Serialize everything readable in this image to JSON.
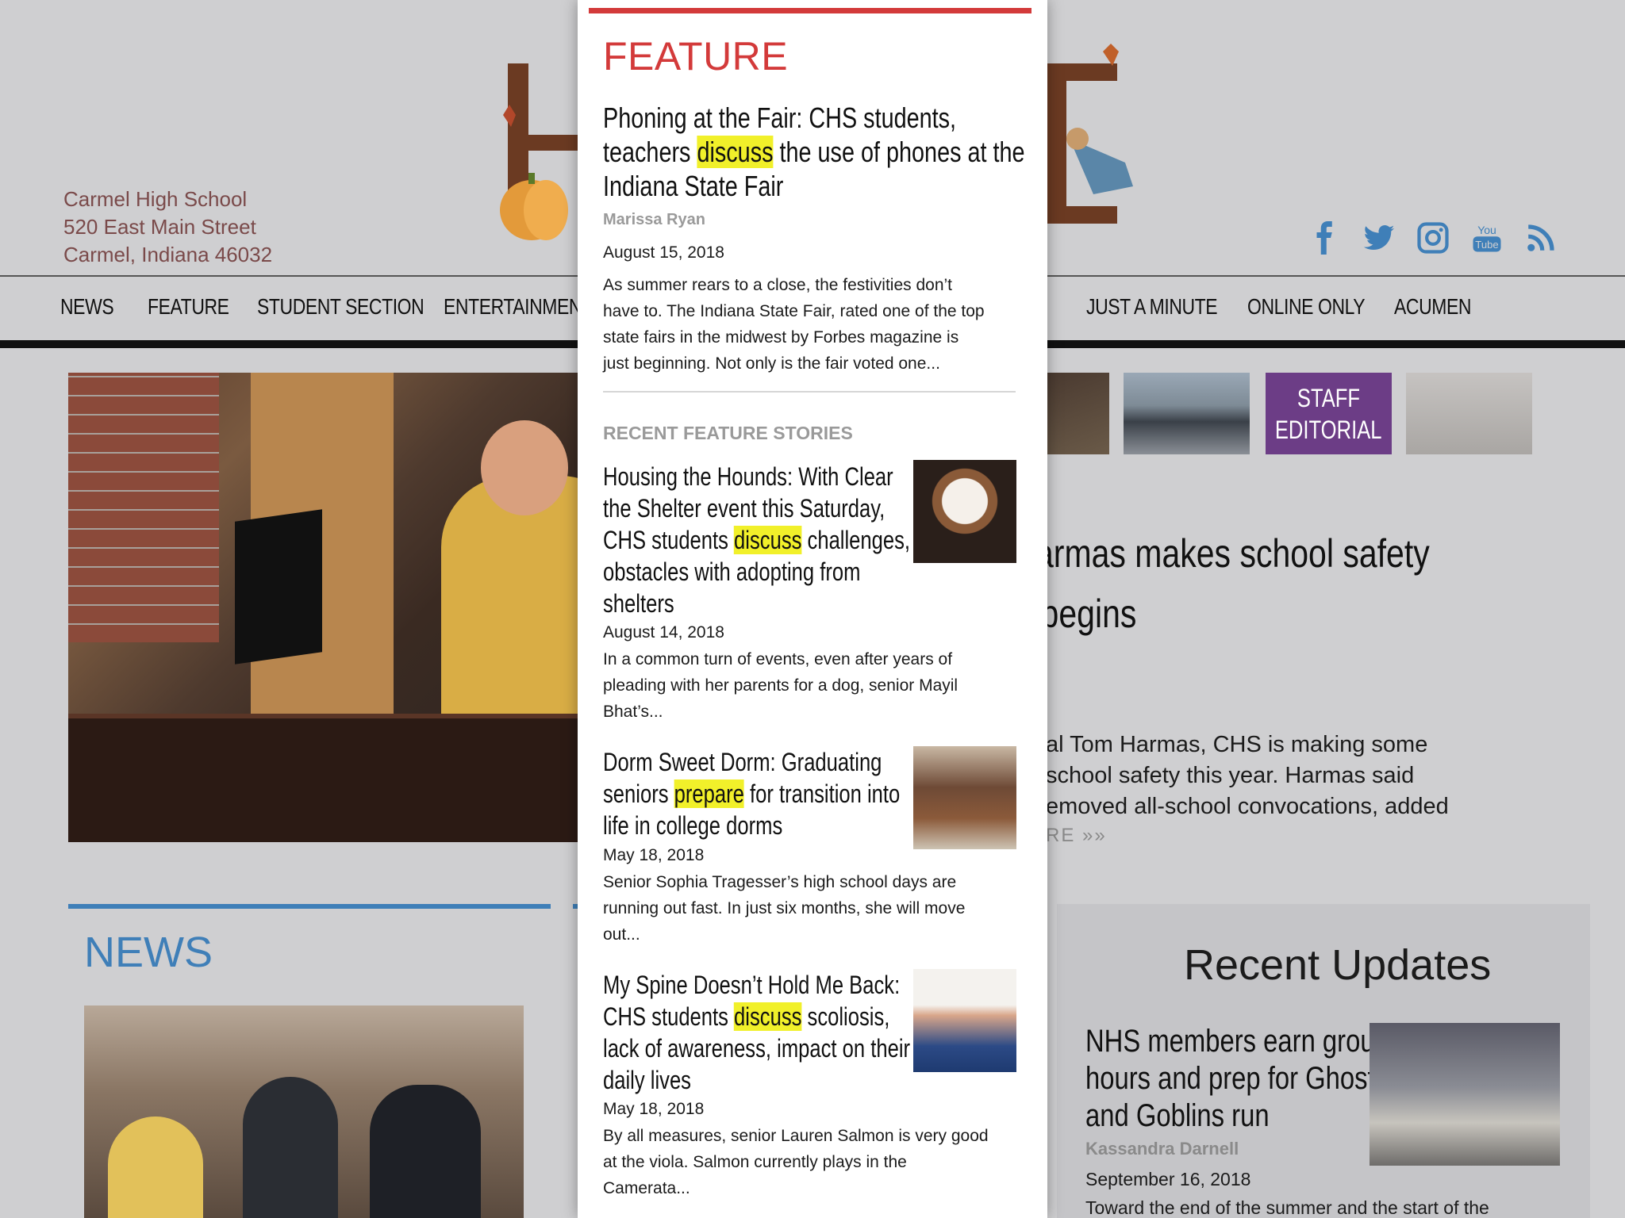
{
  "header": {
    "address_lines": [
      "Carmel High School",
      "520 East Main Street",
      "Carmel, Indiana 46032"
    ],
    "social_icons": [
      "facebook-icon",
      "twitter-icon",
      "instagram-icon",
      "youtube-icon",
      "rss-icon"
    ],
    "youtube_text_top": "You",
    "youtube_text_bottom": "Tube",
    "accent_color": "#3f7fb8"
  },
  "nav": {
    "items": [
      "NEWS",
      "FEATURE",
      "STUDENT SECTION",
      "ENTERTAINMENT",
      "JUST A MINUTE",
      "ONLINE ONLY",
      "ACUMEN"
    ]
  },
  "thumbs": {
    "staff_editorial_1": "STAFF",
    "staff_editorial_2": "EDITORIAL"
  },
  "main_story": {
    "headline_line1": "armas makes school safety",
    "headline_line2": "begins",
    "excerpt_line1": "al Tom Harmas, CHS is making some",
    "excerpt_line2": "school safety this year. Harmas said",
    "excerpt_line3": "emoved all-school convocations, added",
    "more": "RE »»"
  },
  "news_section": {
    "title": "NEWS"
  },
  "recent_updates": {
    "title": "Recent Updates",
    "headline_line1": "NHS members earn group",
    "headline_line2": "hours and prep for Ghost",
    "headline_line3": "and Goblins run",
    "author": "Kassandra Darnell",
    "date": "September 16, 2018",
    "excerpt": "Toward the end of the summer and the start of the"
  },
  "feature_panel": {
    "title": "FEATURE",
    "accent_color": "#d33a3a",
    "highlight_color": "#f1f02a",
    "main": {
      "headline_l1": "Phoning at the Fair: CHS students,",
      "headline_l2_pre": "teachers ",
      "headline_l2_hl": "discuss",
      "headline_l2_post": " the use of phones at the",
      "headline_l3": "Indiana State Fair",
      "author": "Marissa Ryan",
      "date": "August 15, 2018",
      "excerpt_l1": "As summer rears to a close, the festivities don’t",
      "excerpt_l2": "have to. The Indiana State Fair, rated one of the top",
      "excerpt_l3": "state fairs in the midwest by Forbes magazine is",
      "excerpt_l4": "just beginning. Not only is the fair voted one..."
    },
    "recent_label": "RECENT FEATURE STORIES",
    "stories": [
      {
        "h1": "Housing the Hounds: With Clear",
        "h2": "the Shelter event this Saturday,",
        "h3_pre": "CHS students ",
        "h3_hl": "discuss",
        "h3_post": " challenges,",
        "h4": "obstacles with adopting from",
        "h5": "shelters",
        "date": "August 14, 2018",
        "e1": "In a common turn of events, even after years of",
        "e2": "pleading with her parents for a dog, senior Mayil",
        "e3": "Bhat’s..."
      },
      {
        "h1": "Dorm Sweet Dorm: Graduating",
        "h2_pre": "seniors ",
        "h2_hl": "prepare",
        "h2_post": " for transition into",
        "h3": "life in college dorms",
        "date": "May 18, 2018",
        "e1": "Senior Sophia Tragesser’s high school days are",
        "e2": "running out fast. In just six months, she will move",
        "e3": "out..."
      },
      {
        "h1": "My Spine Doesn’t Hold Me Back:",
        "h2_pre": "CHS students ",
        "h2_hl": "discuss",
        "h2_post": " scoliosis,",
        "h3": "lack of awareness, impact on their",
        "h4": "daily lives",
        "date": "May 18, 2018",
        "e1": "By all measures, senior Lauren Salmon is very good",
        "e2": "at the viola. Salmon currently plays in the",
        "e3": "Camerata..."
      }
    ]
  }
}
